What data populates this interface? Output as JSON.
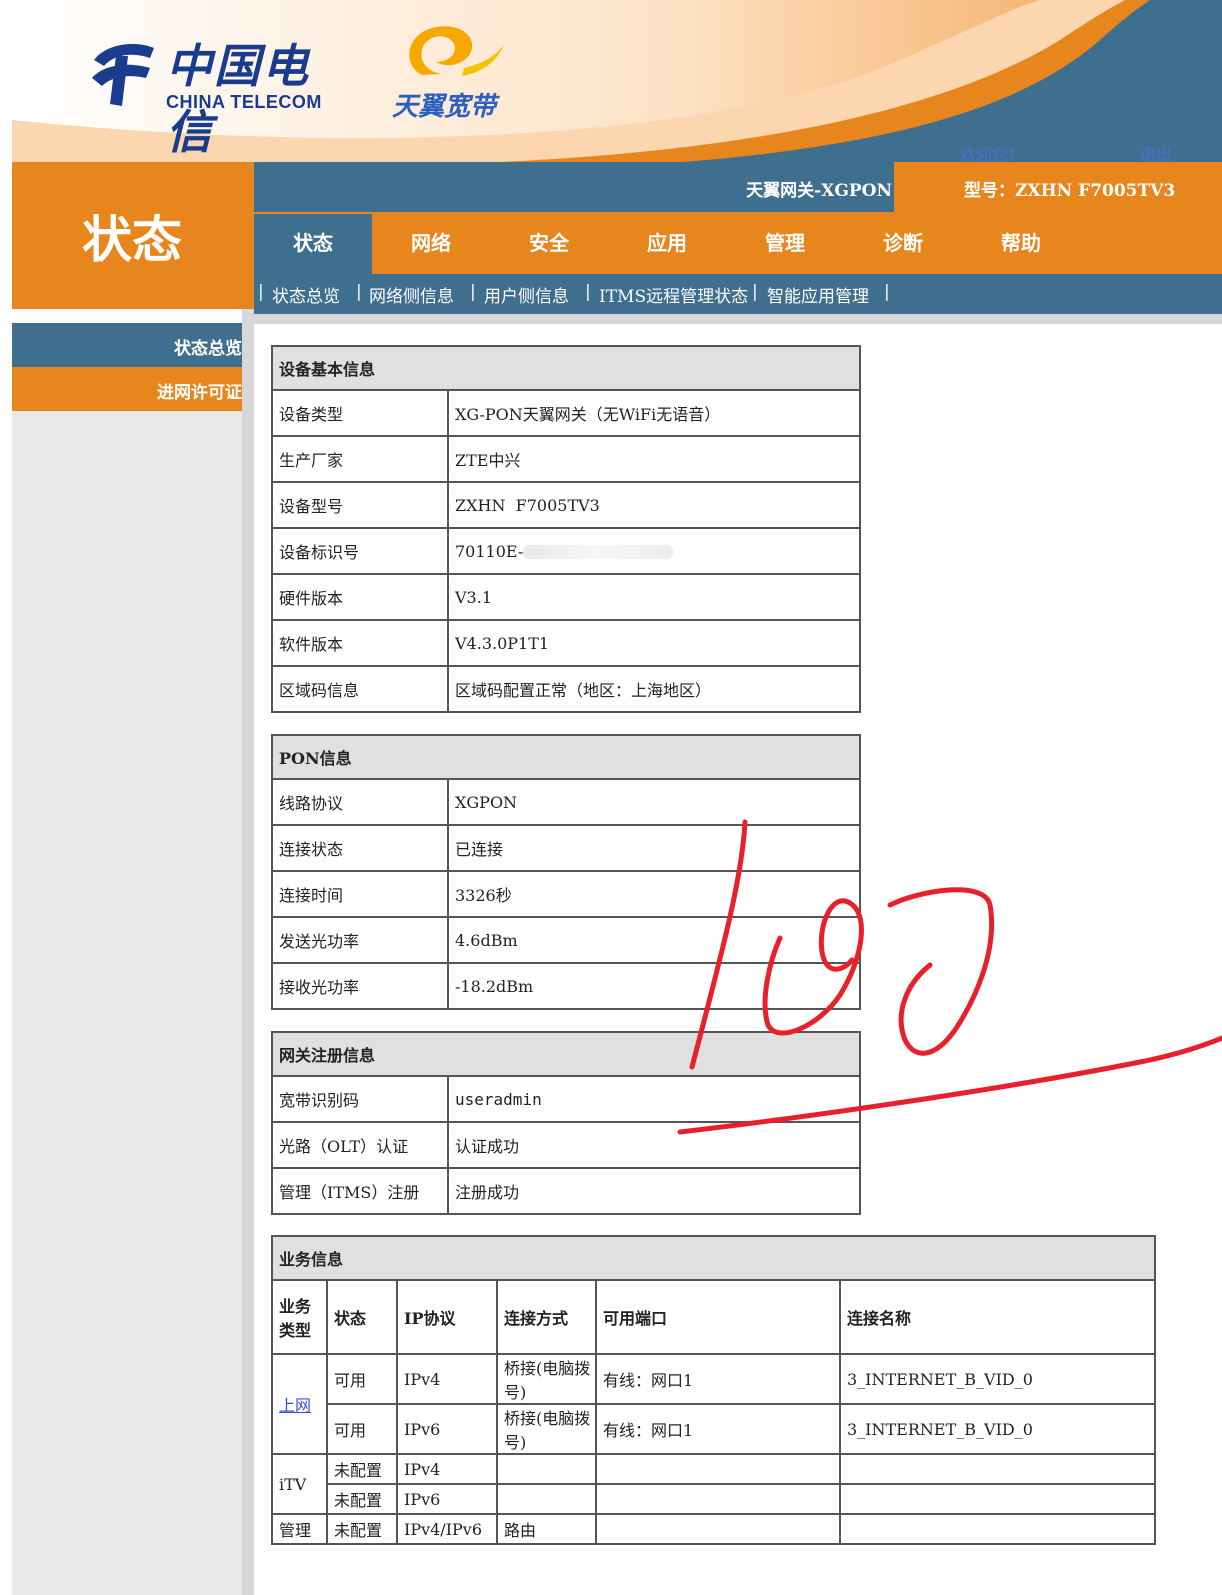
{
  "header": {
    "brand_cn": "中国电信",
    "brand_en": "CHINA TELECOM",
    "broadband_logo": "天翼宽带",
    "welcome": "欢迎您！",
    "logout": "退出",
    "gateway_name": "天翼网关-XGPON",
    "model_label": "型号：ZXHN F7005TV3"
  },
  "page_title": "状态",
  "tabs": [
    {
      "label": "状态"
    },
    {
      "label": "网络"
    },
    {
      "label": "安全"
    },
    {
      "label": "应用"
    },
    {
      "label": "管理"
    },
    {
      "label": "诊断"
    },
    {
      "label": "帮助"
    }
  ],
  "submenu": [
    {
      "label": "状态总览"
    },
    {
      "label": "网络侧信息"
    },
    {
      "label": "用户侧信息"
    },
    {
      "label": "ITMS远程管理状态"
    },
    {
      "label": "智能应用管理"
    }
  ],
  "sidebar": [
    {
      "label": "状态总览"
    },
    {
      "label": "进网许可证"
    }
  ],
  "device_info": {
    "title": "设备基本信息",
    "rows": [
      {
        "k": "设备类型",
        "v": "XG-PON天翼网关（无WiFi无语音）"
      },
      {
        "k": "生产厂家",
        "v": "ZTE中兴"
      },
      {
        "k": "设备型号",
        "v": "ZXHN  F7005TV3"
      },
      {
        "k": "设备标识号",
        "v": "70110E-"
      },
      {
        "k": "硬件版本",
        "v": "V3.1"
      },
      {
        "k": "软件版本",
        "v": "V4.3.0P1T1"
      },
      {
        "k": "区域码信息",
        "v": "区域码配置正常（地区：上海地区）"
      }
    ]
  },
  "pon_info": {
    "title": "PON信息",
    "rows": [
      {
        "k": "线路协议",
        "v": "XGPON"
      },
      {
        "k": "连接状态",
        "v": "已连接"
      },
      {
        "k": "连接时间",
        "v": "3326秒"
      },
      {
        "k": "发送光功率",
        "v": "4.6dBm"
      },
      {
        "k": "接收光功率",
        "v": "-18.2dBm"
      }
    ]
  },
  "gateway_reg": {
    "title": "网关注册信息",
    "rows": [
      {
        "k": "宽带识别码",
        "v": "useradmin"
      },
      {
        "k": "光路（OLT）认证",
        "v": "认证成功"
      },
      {
        "k": "管理（ITMS）注册",
        "v": "注册成功"
      }
    ]
  },
  "service_info": {
    "title": "业务信息",
    "headers": [
      "业务类型",
      "状态",
      "IP协议",
      "连接方式",
      "可用端口",
      "连接名称"
    ],
    "internet_label": "上网",
    "itv_label": "iTV",
    "mgmt_label": "管理",
    "rows": [
      {
        "status": "可用",
        "ip": "IPv4",
        "mode": "桥接(电脑拨号)",
        "port": "有线：网口1",
        "name": "3_INTERNET_B_VID_0"
      },
      {
        "status": "可用",
        "ip": "IPv6",
        "mode": "桥接(电脑拨号)",
        "port": "有线：网口1",
        "name": "3_INTERNET_B_VID_0"
      },
      {
        "status": "未配置",
        "ip": "IPv4",
        "mode": "",
        "port": "",
        "name": ""
      },
      {
        "status": "未配置",
        "ip": "IPv6",
        "mode": "",
        "port": "",
        "name": ""
      },
      {
        "status": "未配置",
        "ip": "IPv4/IPv6",
        "mode": "路由",
        "port": "",
        "name": ""
      }
    ]
  },
  "handwriting": {
    "text": "102",
    "color": "#e8202a"
  },
  "colors": {
    "orange": "#e8861e",
    "steel_blue": "#3f6f8f",
    "link_blue": "#3a4fd8"
  }
}
